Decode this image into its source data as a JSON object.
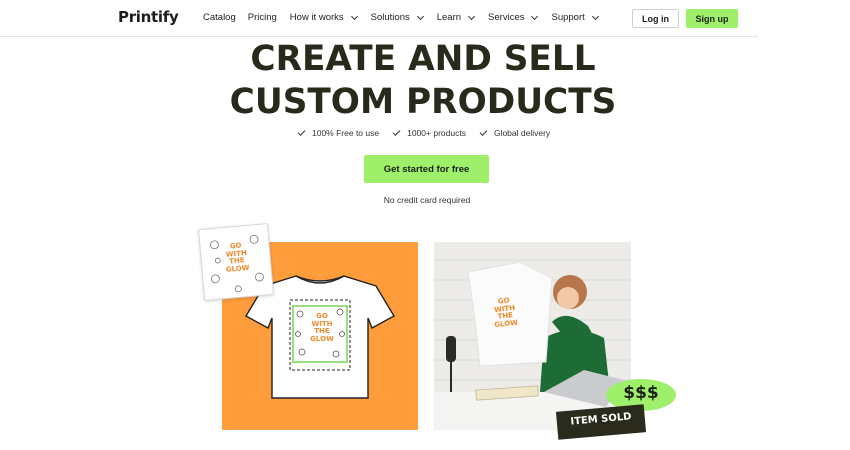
{
  "brand": {
    "logo_text": "Printify"
  },
  "nav": {
    "items": [
      {
        "label": "Catalog",
        "has_dropdown": false
      },
      {
        "label": "Pricing",
        "has_dropdown": false
      },
      {
        "label": "How it works",
        "has_dropdown": true
      },
      {
        "label": "Solutions",
        "has_dropdown": true
      },
      {
        "label": "Learn",
        "has_dropdown": true
      },
      {
        "label": "Services",
        "has_dropdown": true
      },
      {
        "label": "Support",
        "has_dropdown": true
      }
    ],
    "login_label": "Log in",
    "signup_label": "Sign up"
  },
  "hero": {
    "title_line1": "CREATE AND SELL",
    "title_line2": "CUSTOM PRODUCTS",
    "features": [
      "100% Free to use",
      "1000+ products",
      "Global delivery"
    ],
    "cta_label": "Get started for free",
    "cta_note": "No credit card required"
  },
  "visuals": {
    "design_text": [
      "GO",
      "WITH",
      "THE",
      "GLOW"
    ],
    "money_badge": "$$$",
    "sold_badge": "ITEM SOLD"
  },
  "colors": {
    "accent_green": "#9ef06a",
    "panel_orange": "#ff9c3c",
    "dark_text": "#2a2a1c",
    "sweater_green": "#1d6b35"
  }
}
